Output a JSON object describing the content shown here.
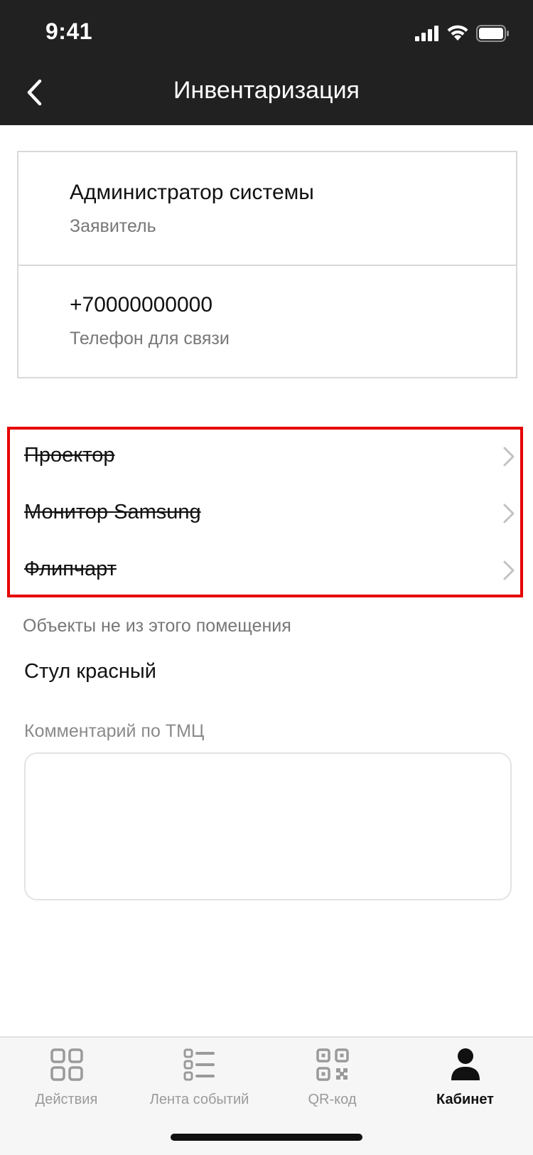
{
  "status_bar": {
    "time": "9:41"
  },
  "header": {
    "title": "Инвентаризация"
  },
  "info_card": {
    "applicant_name": "Администратор системы",
    "applicant_label": "Заявитель",
    "phone": "+70000000000",
    "phone_label": "Телефон для связи"
  },
  "room_items": [
    {
      "label": "Проектор"
    },
    {
      "label": "Монитор Samsung"
    },
    {
      "label": "Флипчарт"
    }
  ],
  "outside_section": {
    "caption": "Объекты не из этого помещения",
    "items": [
      {
        "label": "Стул красный"
      }
    ]
  },
  "comment": {
    "label": "Комментарий по ТМЦ",
    "value": ""
  },
  "tabbar": {
    "tabs": [
      {
        "label": "Действия",
        "icon": "grid-icon",
        "active": false
      },
      {
        "label": "Лента событий",
        "icon": "list-icon",
        "active": false
      },
      {
        "label": "QR-код",
        "icon": "qr-code-icon",
        "active": false
      },
      {
        "label": "Кабинет",
        "icon": "user-icon",
        "active": true
      }
    ]
  },
  "colors": {
    "header_bg": "#212121",
    "highlight": "#e60000",
    "muted_text": "#777777",
    "inactive_tab": "#9a9a9a"
  }
}
